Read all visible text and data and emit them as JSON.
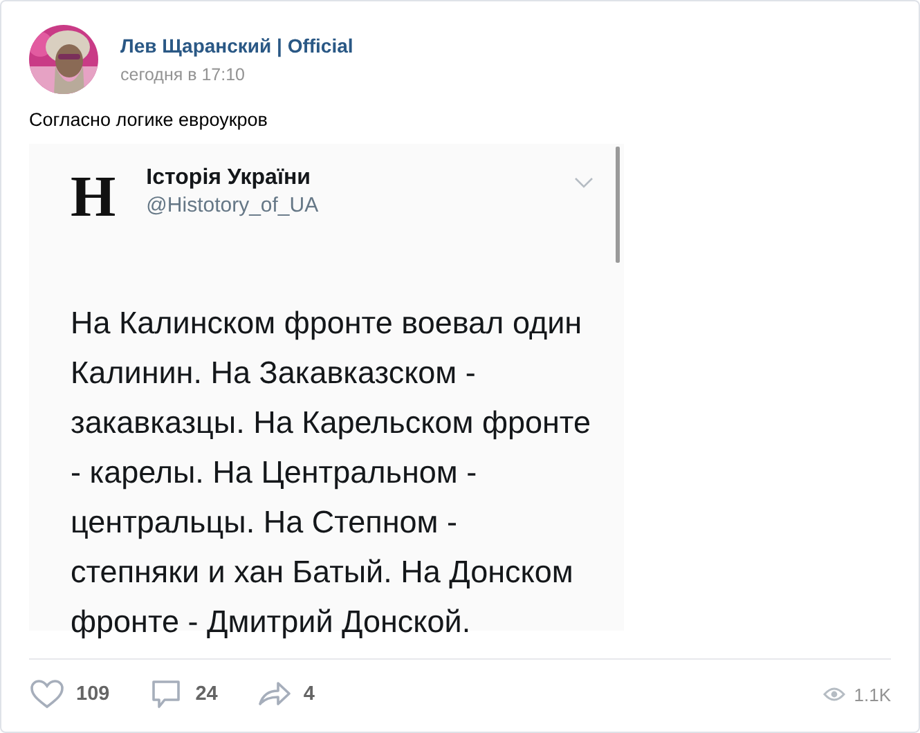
{
  "post": {
    "author": "Лев Щаранский | Official",
    "time": "сегодня в 17:10",
    "text": "Согласно логике евроукров"
  },
  "tweet": {
    "logo": "H",
    "name": "Історія України",
    "handle": "@Histotory_of_UA",
    "lines": [
      "На Калинском фронте воевал один",
      "Калинин. На Закавказском -",
      "закавказцы. На Карельском фронте",
      "- карелы. На Центральном -",
      "центральцы. На Степном -",
      "степняки и хан Батый. На Донском",
      "фронте - Дмитрий Донской."
    ]
  },
  "actions": [
    {
      "kind": "like",
      "count": "109"
    },
    {
      "kind": "comment",
      "count": "24"
    },
    {
      "kind": "share",
      "count": "4"
    }
  ],
  "views": "1.1K"
}
